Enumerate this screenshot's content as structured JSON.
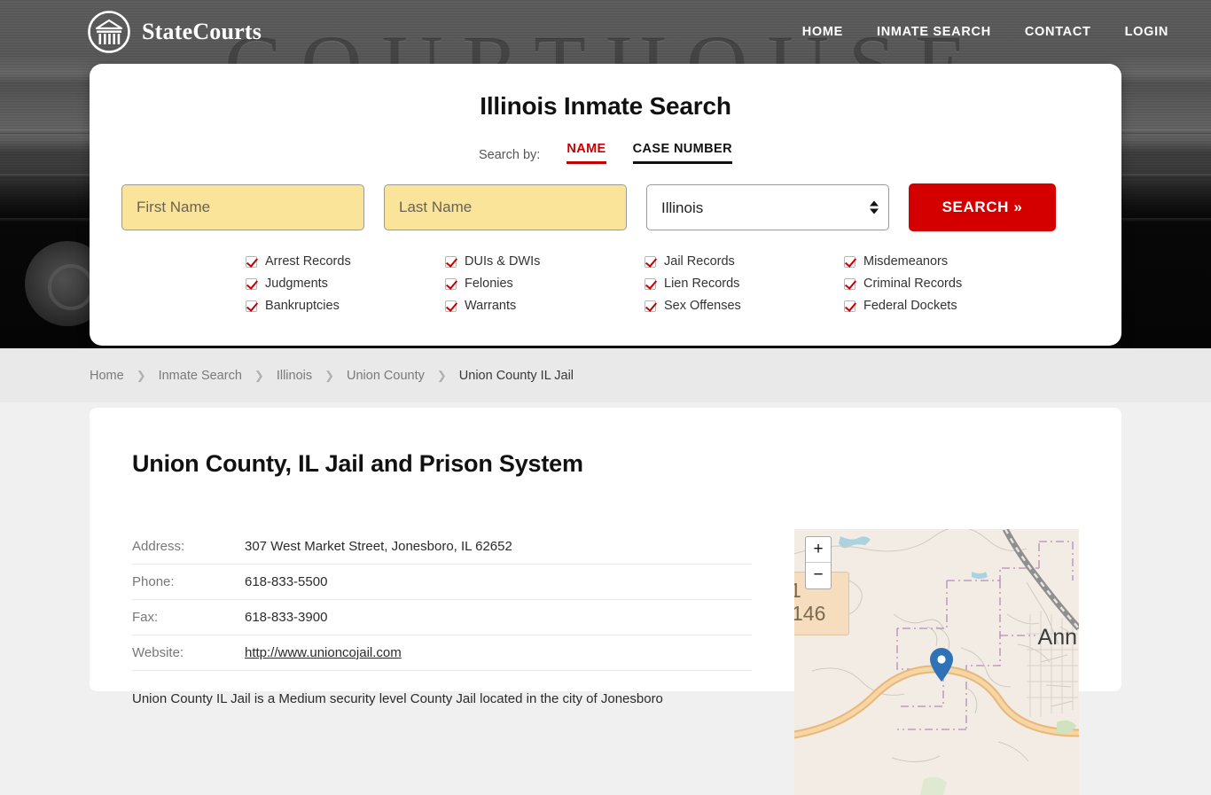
{
  "header": {
    "brand_name": "StateCourts",
    "brand_icon": "courthouse-logo-icon",
    "background_word": "COURTHOUSE",
    "nav": [
      {
        "label": "HOME"
      },
      {
        "label": "INMATE SEARCH"
      },
      {
        "label": "CONTACT"
      },
      {
        "label": "LOGIN"
      }
    ]
  },
  "search_card": {
    "title": "Illinois Inmate Search",
    "search_by_label": "Search by:",
    "tabs": [
      {
        "label": "NAME",
        "active": true
      },
      {
        "label": "CASE NUMBER",
        "active": false
      }
    ],
    "first_name_placeholder": "First Name",
    "first_name_value": "",
    "last_name_placeholder": "Last Name",
    "last_name_value": "",
    "state_selected": "Illinois",
    "state_options": [
      "Illinois"
    ],
    "search_button_label": "SEARCH »",
    "accent_color": "#d40000",
    "field_color": "#fae49a",
    "checkboxes": [
      "Arrest Records",
      "DUIs & DWIs",
      "Jail Records",
      "Misdemeanors",
      "Judgments",
      "Felonies",
      "Lien Records",
      "Criminal Records",
      "Bankruptcies",
      "Warrants",
      "Sex Offenses",
      "Federal Dockets"
    ]
  },
  "breadcrumb": [
    {
      "label": "Home",
      "current": false
    },
    {
      "label": "Inmate Search",
      "current": false
    },
    {
      "label": "Illinois",
      "current": false
    },
    {
      "label": "Union County",
      "current": false
    },
    {
      "label": "Union County IL Jail",
      "current": true
    }
  ],
  "breadcrumb_separator": "❯",
  "main": {
    "title": "Union County, IL Jail and Prison System",
    "rows": [
      {
        "key": "Address:",
        "value": "307 West Market Street, Jonesboro, IL 62652",
        "link": false
      },
      {
        "key": "Phone:",
        "value": "618-833-5500",
        "link": false
      },
      {
        "key": "Fax:",
        "value": "618-833-3900",
        "link": false
      },
      {
        "key": "Website:",
        "value": "http://www.unioncojail.com",
        "link": true
      }
    ],
    "blurb": "Union County IL Jail is a Medium security level County Jail located in the city of Jonesboro"
  },
  "map": {
    "zoom_in_label": "+",
    "zoom_out_label": "−",
    "route_shield_top": "1",
    "route_shield": "146",
    "place_label": "Ann",
    "marker_icon": "map-marker-icon",
    "marker_color": "#2e72b8"
  }
}
